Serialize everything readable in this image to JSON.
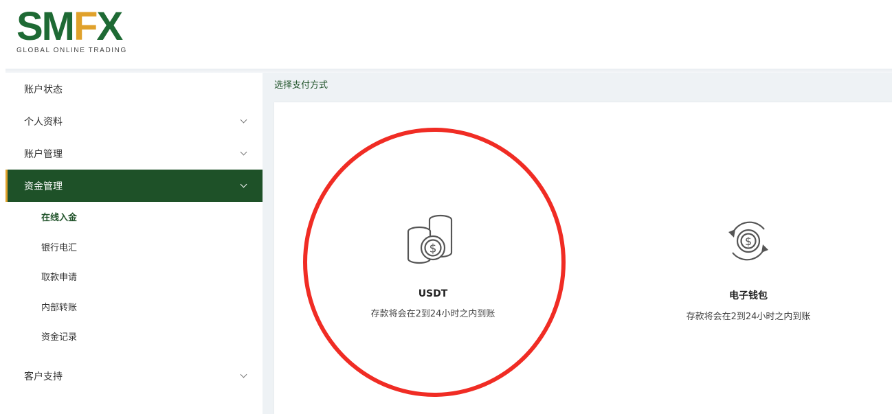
{
  "brand": {
    "logo_main": "SM",
    "logo_accent": "F",
    "logo_end": "X",
    "tagline": "GLOBAL ONLINE TRADING",
    "primary_color": "#1e6a34",
    "accent_color": "#e0a12b"
  },
  "sidebar": {
    "items": [
      {
        "label": "账户状态"
      },
      {
        "label": "个人资料"
      },
      {
        "label": "账户管理"
      },
      {
        "label": "资金管理"
      }
    ],
    "submenu": [
      {
        "label": "在线入金"
      },
      {
        "label": "银行电汇"
      },
      {
        "label": "取款申请"
      },
      {
        "label": "内部转账"
      },
      {
        "label": "资金记录"
      }
    ],
    "support": {
      "label": "客户支持"
    },
    "active_color": "#1e5128"
  },
  "main": {
    "breadcrumb": "选择支付方式",
    "options": [
      {
        "title": "USDT",
        "description": "存款将会在2到24小时之内到账",
        "icon": "coins-stack-icon"
      },
      {
        "title": "电子钱包",
        "description": "存款将会在2到24小时之内到账",
        "icon": "circular-dollar-arrows-icon"
      }
    ],
    "highlight_color": "#f02c24"
  }
}
